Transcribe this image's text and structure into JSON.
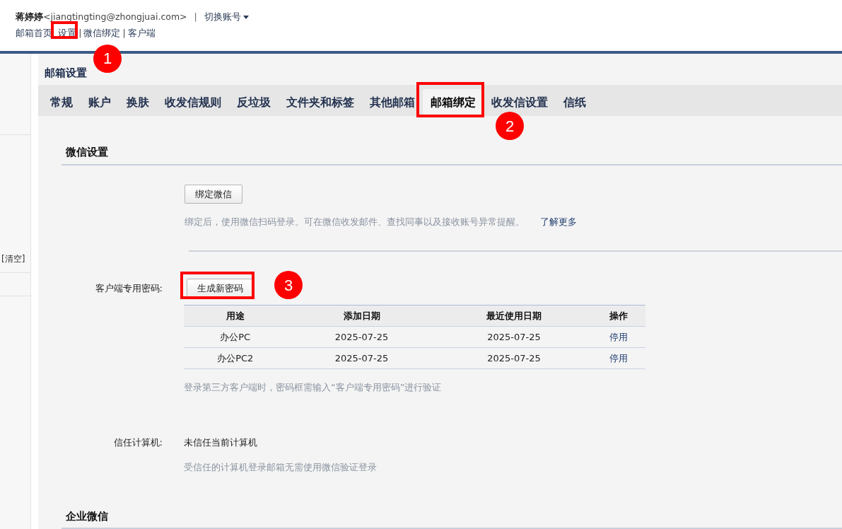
{
  "header": {
    "user_name": "蒋婷婷",
    "user_email": "<jiangtingting@zhongjuai.com>",
    "separator": "|",
    "switch_account": "切换账号",
    "links": [
      {
        "label": "邮箱首页"
      },
      {
        "label": "设置"
      },
      {
        "label": "微信绑定"
      },
      {
        "label": "客户端"
      }
    ]
  },
  "sidebar": {
    "clear_link": "[清空]"
  },
  "page_title": "邮箱设置",
  "tabs": [
    {
      "label": "常规",
      "selected": false
    },
    {
      "label": "账户",
      "selected": false
    },
    {
      "label": "换肤",
      "selected": false
    },
    {
      "label": "收发信规则",
      "selected": false
    },
    {
      "label": "反垃圾",
      "selected": false
    },
    {
      "label": "文件夹和标签",
      "selected": false
    },
    {
      "label": "其他邮箱",
      "selected": false
    },
    {
      "label": "邮箱绑定",
      "selected": true
    },
    {
      "label": "收发信设置",
      "selected": false
    },
    {
      "label": "信纸",
      "selected": false
    }
  ],
  "wechat_section": {
    "title": "微信设置",
    "bind_button": "绑定微信",
    "help": "绑定后，使用微信扫码登录。可在微信收发邮件、查找同事以及接收账号异常提醒。",
    "learn_more": "了解更多"
  },
  "client_password": {
    "label": "客户端专用密码:",
    "generate_button": "生成新密码",
    "table": {
      "columns": [
        "用途",
        "添加日期",
        "最近使用日期",
        "操作"
      ],
      "rows": [
        {
          "cells": [
            "办公PC",
            "2025-07-25",
            "2025-07-25",
            "停用"
          ]
        },
        {
          "cells": [
            "办公PC2",
            "2025-07-25",
            "2025-07-25",
            "停用"
          ]
        }
      ]
    },
    "note": "登录第三方客户端时，密码框需输入“客户端专用密码”进行验证"
  },
  "trusted_computer": {
    "label": "信任计算机:",
    "value": "未信任当前计算机",
    "help": "受信任的计算机登录邮箱无需使用微信验证登录"
  },
  "enterprise_section": {
    "title": "企业微信"
  },
  "annotations": [
    {
      "label": "1"
    },
    {
      "label": "2"
    },
    {
      "label": "3"
    }
  ]
}
